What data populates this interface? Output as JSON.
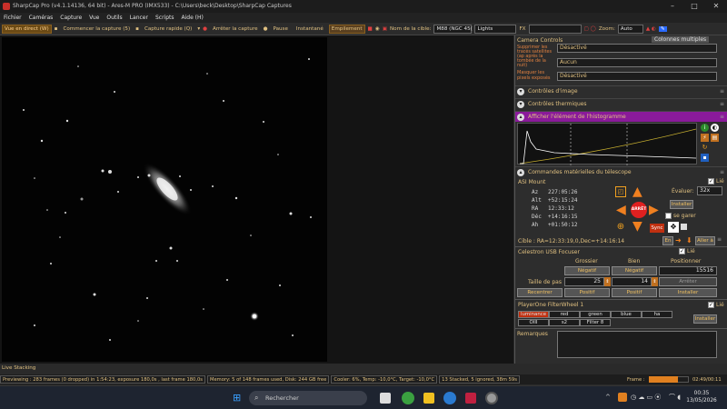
{
  "window": {
    "title": "SharpCap Pro (v4.1.14136, 64 bit) - Ares-M PRO (IMX533) - C:\\Users\\beck\\Desktop\\SharpCap Captures"
  },
  "menu": [
    "Fichier",
    "Caméras",
    "Capture",
    "Vue",
    "Outils",
    "Lancer",
    "Scripts",
    "Aide (H)"
  ],
  "toolbar": {
    "live": "Vue en direct (W)",
    "start_capture": "Commencer la capture (5)",
    "quick_capture": "Capture rapide (Q)",
    "stop_capture": "Arrêter la capture",
    "pause": "Pause",
    "snapshot": "Instantané",
    "stack": "Empilement",
    "target_label": "Nom de la cible:",
    "target_value": "M88 (NGC 45(",
    "frame_type": "Lights",
    "fx": "FX",
    "zoom_label": "Zoom:",
    "zoom_value": "Auto"
  },
  "panel": {
    "header": "Camera Controls",
    "multicol": "Colonnes multiples",
    "row1_label": "Supprimer les tracés satellites (ap après la tombée de la nuit)",
    "row1_value": "Désactivé",
    "row2_value": "Aucun",
    "row3_label": "Masquer les pixels exposés",
    "row3_value": "Désactivé",
    "sec_image": "Contrôles d'image",
    "sec_thermal": "Contrôles thermiques",
    "sec_histo": "Afficher l'élément de l'histogramme",
    "sec_scope": "Commandes matérielles du télescope",
    "mount": {
      "title": "ASI Mount",
      "evaluer_label": "Évaluer:",
      "evaluer_value": "32x",
      "install": "Installer",
      "parking": "se garer",
      "az_label": "Az",
      "az": "227:05:26",
      "alt_label": "Alt",
      "alt": "+52:15:24",
      "ra_label": "RA",
      "ra": "12:33:12",
      "dec_label": "Déc",
      "dec": "+14:16:15",
      "ah_label": "Ah",
      "ah": "+01:50:12",
      "target": "Cible : RA=12:33:19,0,Dec=+14:16:14",
      "stop": "ARRÊT",
      "sync": "Sync",
      "en": "En",
      "go": "Aller à",
      "lie": "Lié"
    },
    "focuser": {
      "title": "Celestron USB Focuser",
      "coarse": "Grossier",
      "fine": "Bien",
      "position": "Positionner",
      "neg": "Négatif",
      "neg2": "Négatif",
      "pos_value": "15516",
      "step_label": "Taille de pas",
      "step_coarse": "25",
      "step_fine": "14",
      "stop": "Arrêter",
      "refocus": "Recentrer",
      "pos": "Positif",
      "pos2": "Positif",
      "install": "Installer",
      "lie": "Lié"
    },
    "filter": {
      "title": "PlayerOne FilterWheel 1",
      "filters": [
        "luminance",
        "red",
        "green",
        "blue",
        "ha",
        "OIII",
        "s2",
        "Filter 8"
      ],
      "install": "Installer",
      "lie": "Lié"
    },
    "remarks": "Remarques"
  },
  "status": {
    "live_stacking": "Live Stacking",
    "preview": "Previewing : 283 frames (0 dropped) in 1:54:23, exposure 180,0s , last frame 180,0s",
    "memory": "Memory: 5 of 148 frames used, Disk: 244 GB free",
    "cooler": "Cooler: 6%, Temp: -10,0°C, Target: -10,0°C",
    "stacked": "13 Stacked, 5 ignored, 38m 59s",
    "frame_label": "Frame :",
    "frame_time": "02:49/00:11",
    "frame_progress": 0.72
  },
  "taskbar": {
    "search": "Rechercher",
    "time": "00:35",
    "date": "13/05/2026"
  },
  "colors": {
    "accent": "#e08020",
    "histo_header": "#8a1a9a",
    "text": "#e0c080"
  }
}
